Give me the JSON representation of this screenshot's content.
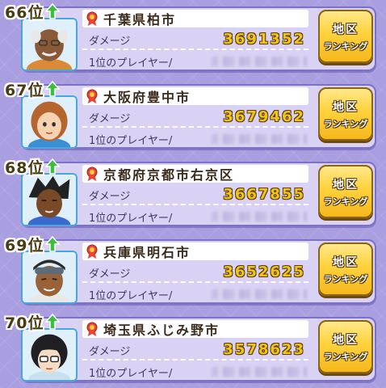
{
  "ranking": {
    "damage_label": "ダメージ",
    "player_label": "1位のプレイヤー/",
    "button_line1": "地区",
    "button_line2": "ランキング",
    "entries": [
      {
        "rank": "66位",
        "city": "千葉県柏市",
        "damage": "3691352",
        "avatar": "elderly-man-avatar"
      },
      {
        "rank": "67位",
        "city": "大阪府豊中市",
        "damage": "3679462",
        "avatar": "brown-hair-girl-avatar"
      },
      {
        "rank": "68位",
        "city": "京都府京都市右京区",
        "damage": "3667855",
        "avatar": "dreadlock-boy-avatar"
      },
      {
        "rank": "69位",
        "city": "兵庫県明石市",
        "damage": "3652625",
        "avatar": "goggles-man-avatar"
      },
      {
        "rank": "70位",
        "city": "埼玉県ふじみ野市",
        "damage": "3578623",
        "avatar": "glasses-girl-avatar"
      }
    ]
  },
  "colors": {
    "background": "#a89ee0",
    "card": "#d9d2f4",
    "damage_gold": "#f3c31a",
    "button_gold": "#ffd23c",
    "arrow_green": "#3cbf3c"
  }
}
